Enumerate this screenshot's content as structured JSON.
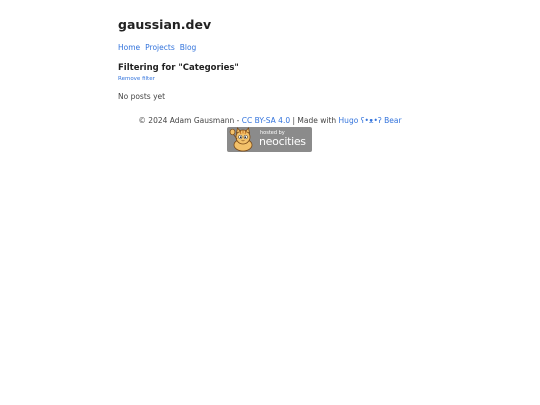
{
  "header": {
    "site_title": "gaussian.dev"
  },
  "nav": {
    "items": [
      {
        "label": "Home"
      },
      {
        "label": "Projects"
      },
      {
        "label": "Blog"
      }
    ]
  },
  "main": {
    "filter_heading": "Filtering for \"Categories\"",
    "remove_filter_label": "Remove filter",
    "empty_message": "No posts yet"
  },
  "footer": {
    "copyright": "© 2024 Adam Gausmann - ",
    "license_link": "CC BY-SA 4.0",
    "made_with": " | Made with ",
    "hugo_link": "Hugo ʕ•ᴥ•ʔ Bear"
  },
  "badge": {
    "hosted_by": "hosted by",
    "name": "neocities",
    "icon": "neocities-cat-icon"
  }
}
